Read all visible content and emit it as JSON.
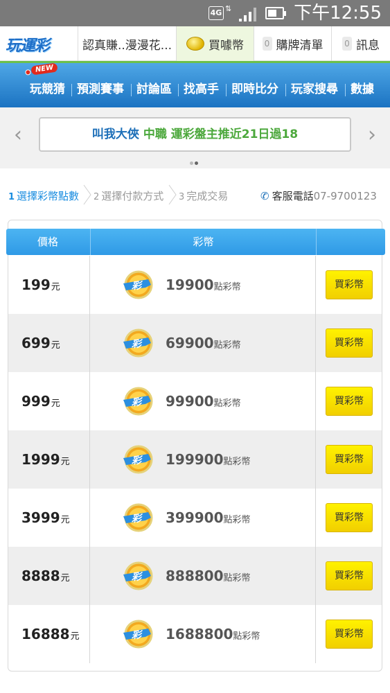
{
  "status_bar": {
    "network": "4G",
    "updown": "⇅",
    "time": "下午12:55"
  },
  "top_nav": {
    "logo": "玩運彩",
    "tabs": [
      {
        "label": "認真賺..漫漫花..."
      },
      {
        "label": "買噱幣"
      },
      {
        "badge": "0",
        "label": "購牌清單"
      },
      {
        "badge": "0",
        "label": "訊息"
      }
    ]
  },
  "menu": {
    "new_badge": "NEW",
    "items": [
      "玩競猜",
      "預測賽事",
      "討論區",
      "找高手",
      "即時比分",
      "玩家搜尋",
      "數據"
    ]
  },
  "ticker": {
    "name": "叫我大俠",
    "message": "中職 運彩盤主推近21日過18",
    "arrow_left": "‹",
    "arrow_right": "›"
  },
  "steps": [
    {
      "num": "1",
      "label": "選擇彩幣點數"
    },
    {
      "num": "2",
      "label": "選擇付款方式"
    },
    {
      "num": "3",
      "label": "完成交易"
    }
  ],
  "service": {
    "label": "客服電話",
    "number": "07-9700123"
  },
  "table": {
    "headers": [
      "價格",
      "彩幣"
    ],
    "currency_unit": "元",
    "points_unit": "點彩幣",
    "buy_label": "買彩幣",
    "rows": [
      {
        "price": "199",
        "points": "19900"
      },
      {
        "price": "699",
        "points": "69900"
      },
      {
        "price": "999",
        "points": "99900"
      },
      {
        "price": "1999",
        "points": "199900"
      },
      {
        "price": "3999",
        "points": "399900"
      },
      {
        "price": "8888",
        "points": "888800"
      },
      {
        "price": "16888",
        "points": "1688800"
      }
    ]
  },
  "colors": {
    "brand_blue": "#1b73c2",
    "accent_green": "#4ca83c",
    "button_yellow": "#fff200",
    "step_active": "#1a8de0"
  }
}
